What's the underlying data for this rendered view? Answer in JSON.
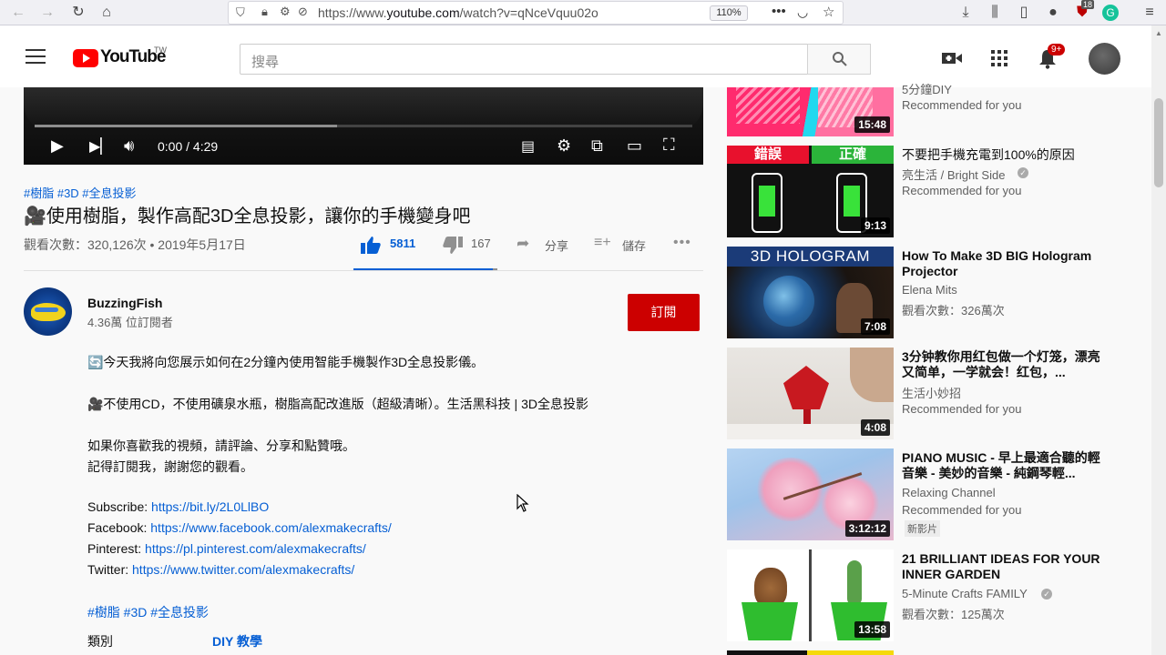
{
  "browser": {
    "url_prefix": "https://www.",
    "url_domain": "youtube.com",
    "url_path": "/watch?v=qNceVquu02o",
    "zoom": "110%",
    "badge_count": "18"
  },
  "masthead": {
    "logo_text": "YouTube",
    "logo_region": "TW",
    "search_placeholder": "搜尋",
    "notification_badge": "9+"
  },
  "player": {
    "time": "0:00 / 4:29",
    "buffered_fraction": 0.46
  },
  "video": {
    "tags": "#樹脂 #3D #全息投影",
    "title": "🎥使用樹脂，製作高配3D全息投影，讓你的手機變身吧",
    "views_date": "觀看次數：320,126次 • 2019年5月17日",
    "likes": "5811",
    "dislikes": "167",
    "share_label": "分享",
    "save_label": "儲存",
    "like_ratio": 0.97
  },
  "channel": {
    "name": "BuzzingFish",
    "subscribers": "4.36萬 位訂閱者",
    "subscribe_label": "訂閱"
  },
  "description": {
    "line1": "🔄今天我將向您展示如何在2分鐘內使用智能手機製作3D全息投影儀。",
    "line2": "🎥不使用CD，不使用礦泉水瓶，樹脂高配改進版（超級清晰）。生活黑科技 | 3D全息投影",
    "line3": "如果你喜歡我的視頻，請評論、分享和點贊哦。",
    "line4": "記得訂閱我，謝謝您的觀看。",
    "links": [
      {
        "label": "Subscribe:",
        "url": "https://bit.ly/2L0LlBO"
      },
      {
        "label": "Facebook:",
        "url": "https://www.facebook.com/alexmakecrafts/"
      },
      {
        "label": "Pinterest:",
        "url": "https://pl.pinterest.com/alexmakecrafts/"
      },
      {
        "label": "Twitter:",
        "url": "https://www.twitter.com/alexmakecrafts/"
      }
    ],
    "tags": "#樹脂 #3D #全息投影",
    "category_label": "類別",
    "category_value": "DIY 教學"
  },
  "recommendations": [
    {
      "title": "5分鐘DIY",
      "line2": "Recommended for you",
      "line3": "",
      "duration": "15:48"
    },
    {
      "title": "不要把手機充電到100%的原因",
      "line2": "亮生活 / Bright Side",
      "line3": "Recommended for you",
      "duration": "9:13",
      "thumb_left": "錯誤",
      "thumb_right": "正確"
    },
    {
      "title": "How To Make 3D BIG Hologram Projector",
      "line2": "Elena Mits",
      "line3": "觀看次數：326萬次",
      "duration": "7:08",
      "thumb_text": "3D HOLOGRAM"
    },
    {
      "title": "3分钟教你用红包做一个灯笼，漂亮又简单，一学就会！红包，...",
      "line2": "生活小妙招",
      "line3": "Recommended for you",
      "duration": "4:08"
    },
    {
      "title": "PIANO MUSIC - 早上最適合聽的輕音樂 - 美妙的音樂 - 純鋼琴輕...",
      "line2": "Relaxing Channel",
      "line3": "Recommended for you",
      "line4": "新影片",
      "duration": "3:12:12"
    },
    {
      "title": "21 BRILLIANT IDEAS FOR YOUR INNER GARDEN",
      "line2": "5-Minute Crafts FAMILY",
      "line3": "觀看次數：125萬次",
      "duration": "13:58"
    }
  ]
}
